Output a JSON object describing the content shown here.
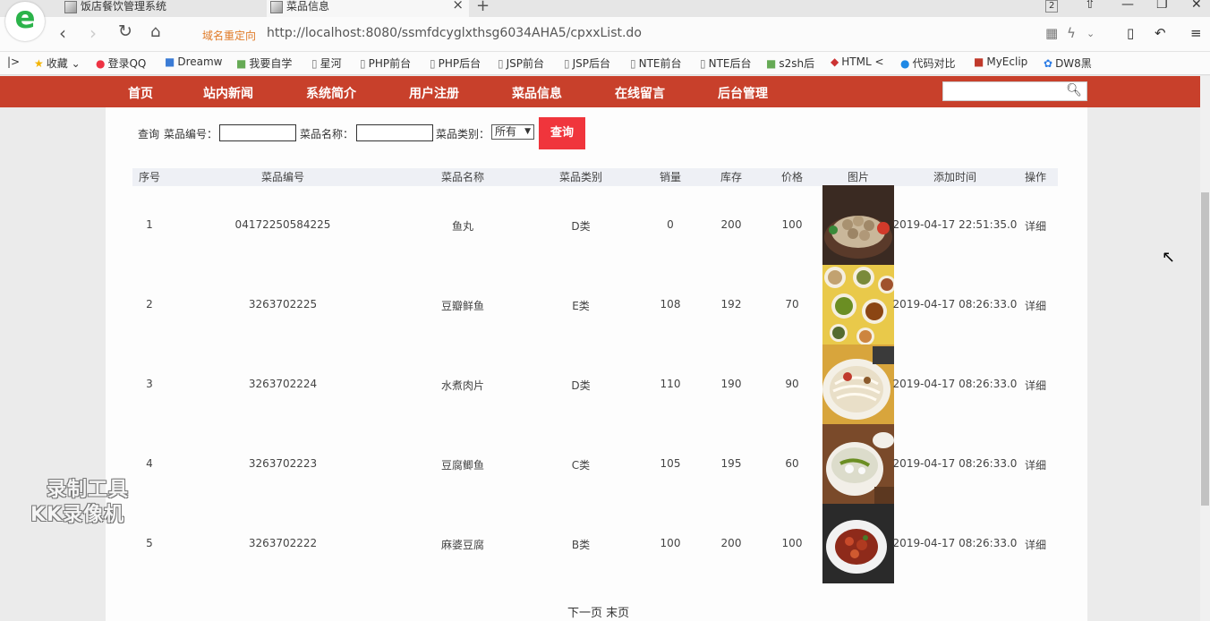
{
  "browser": {
    "tabs": [
      {
        "label": "饭店餐饮管理系统"
      },
      {
        "label": "菜品信息"
      }
    ],
    "tab_count": "2",
    "redirect_label": "域名重定向",
    "url": "http://localhost:8080/ssmfdcyglxthsg6034AHA5/cpxxList.do",
    "bookmarks": [
      {
        "label": "收藏"
      },
      {
        "label": "登录QQ"
      },
      {
        "label": "Dreamw"
      },
      {
        "label": "我要自学"
      },
      {
        "label": "星河"
      },
      {
        "label": "PHP前台"
      },
      {
        "label": "PHP后台"
      },
      {
        "label": "JSP前台"
      },
      {
        "label": "JSP后台"
      },
      {
        "label": "NTE前台"
      },
      {
        "label": "NTE后台"
      },
      {
        "label": "s2sh后"
      },
      {
        "label": "HTML <"
      },
      {
        "label": "代码对比"
      },
      {
        "label": "MyEclip"
      },
      {
        "label": "DW8黑"
      }
    ]
  },
  "nav": {
    "items": [
      {
        "label": "首页"
      },
      {
        "label": "站内新闻"
      },
      {
        "label": "系统简介"
      },
      {
        "label": "用户注册"
      },
      {
        "label": "菜品信息"
      },
      {
        "label": "在线留言"
      },
      {
        "label": "后台管理"
      }
    ]
  },
  "query": {
    "label_query": "查询",
    "label_code": "菜品编号：",
    "label_name": "菜品名称：",
    "label_category": "菜品类别：",
    "category_value": "所有",
    "button": "查询"
  },
  "table": {
    "headers": [
      "序号",
      "菜品编号",
      "菜品名称",
      "菜品类别",
      "销量",
      "库存",
      "价格",
      "图片",
      "添加时间",
      "操作"
    ],
    "rows": [
      {
        "index": "1",
        "code": "04172250584225",
        "name": "鱼丸",
        "category": "D类",
        "sales": "0",
        "stock": "200",
        "price": "100",
        "time": "2019-04-17 22:51:35.0",
        "action": "详细"
      },
      {
        "index": "2",
        "code": "3263702225",
        "name": "豆瓣鲜鱼",
        "category": "E类",
        "sales": "108",
        "stock": "192",
        "price": "70",
        "time": "2019-04-17 08:26:33.0",
        "action": "详细"
      },
      {
        "index": "3",
        "code": "3263702224",
        "name": "水煮肉片",
        "category": "D类",
        "sales": "110",
        "stock": "190",
        "price": "90",
        "time": "2019-04-17 08:26:33.0",
        "action": "详细"
      },
      {
        "index": "4",
        "code": "3263702223",
        "name": "豆腐鲫鱼",
        "category": "C类",
        "sales": "105",
        "stock": "195",
        "price": "60",
        "time": "2019-04-17 08:26:33.0",
        "action": "详细"
      },
      {
        "index": "5",
        "code": "3263702222",
        "name": "麻婆豆腐",
        "category": "B类",
        "sales": "100",
        "stock": "200",
        "price": "100",
        "time": "2019-04-17 08:26:33.0",
        "action": "详细"
      }
    ]
  },
  "pager": {
    "next": "下一页",
    "last": "末页"
  },
  "watermark": {
    "line1": "录制工具",
    "line2": "KK录像机"
  },
  "colors": {
    "nav": "#c8402b",
    "button": "#f0353c",
    "redirect": "#e07b28"
  }
}
